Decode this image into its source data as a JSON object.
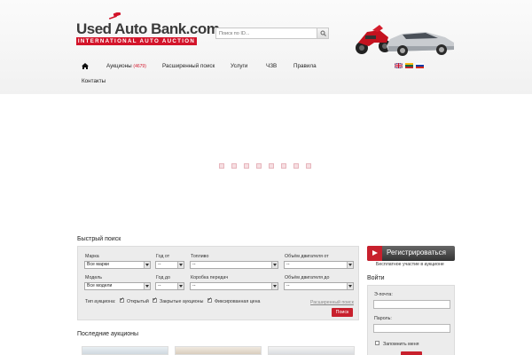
{
  "header": {
    "logo": {
      "main": "Used Auto Bank.com",
      "sub": "INTERNATIONAL AUTO AUCTION"
    },
    "search": {
      "placeholder": "Поиск по ID..."
    },
    "icons": [
      "gavel-icon",
      "search-icon",
      "motorcycle-icon",
      "car-icon"
    ]
  },
  "nav": {
    "home_icon": "home-icon",
    "items": [
      {
        "label": "Аукционы",
        "count": "(4679)"
      },
      {
        "label": "Расширенный поиск"
      },
      {
        "label": "Услуги"
      },
      {
        "label": "ЧЗВ"
      },
      {
        "label": "Правила"
      },
      {
        "label": "Контакты"
      }
    ],
    "flags": [
      "flag-gb-icon",
      "flag-lt-icon",
      "flag-ru-icon"
    ]
  },
  "slider": {
    "loader_count": 8
  },
  "quick_search": {
    "title": "Быстрый поиск",
    "labels": {
      "make": "Марка",
      "year_from": "Год от",
      "fuel": "Топливо",
      "engine_from": "Объём двигателя от",
      "model": "Модель",
      "year_to": "Год до",
      "gearbox": "Коробка передач",
      "engine_to": "Объём двигателя до"
    },
    "values": {
      "make": "Все марки",
      "year_from": "--",
      "fuel": "--",
      "engine_from": "--",
      "model": "Все модели",
      "year_to": "--",
      "gearbox": "--",
      "engine_to": "--"
    },
    "auction_type": {
      "label": "Тип аукциона:",
      "options": [
        {
          "label": "Открытый",
          "checked": true
        },
        {
          "label": "Закрытые аукционы",
          "checked": true
        },
        {
          "label": "Фиксированная цена",
          "checked": true
        }
      ]
    },
    "advanced_link": "Расширенный поиск",
    "submit": "Поиск"
  },
  "register": {
    "button": "Регистрироваться",
    "free_text": "Бесплатное участие в аукционе"
  },
  "login": {
    "title": "Войти",
    "email_label": "Э-почта:",
    "password_label": "Пароль:",
    "remember_label": "Запомнить меня"
  },
  "latest_auctions": {
    "title": "Последние аукционы"
  },
  "colors": {
    "accent": "#d3142a",
    "panel": "#ececec",
    "button_dark": "#444444"
  }
}
